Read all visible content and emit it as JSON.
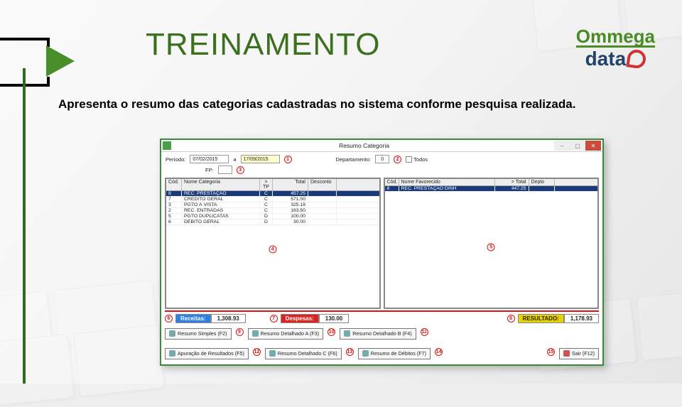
{
  "slide": {
    "title": "TREINAMENTO",
    "logo_top": "Ommega",
    "logo_bot": "data",
    "body": "Apresenta o resumo das categorias cadastradas no sistema conforme pesquisa realizada."
  },
  "window": {
    "title": "Resumo Categoria",
    "filters": {
      "periodo_label": "Período:",
      "periodo_de": "07/02/2015",
      "a_label": "a",
      "periodo_ate": "17/09/2015",
      "departamento_label": "Departamento:",
      "departamento_num": "0",
      "todos_label": "Todos",
      "fp_label": "FP:"
    },
    "left": {
      "headers": {
        "cod": "Cód.",
        "nome": "Nome Categoria",
        "tp": "> TP",
        "total": "Total",
        "desconto": "Desconto"
      },
      "rows": [
        {
          "cod": "8",
          "nome": "REC. PRESTAÇÃO",
          "tp": "C",
          "total": "457.25",
          "desconto": ""
        },
        {
          "cod": "7",
          "nome": "CRÉDITO GERAL",
          "tp": "C",
          "total": "571.00",
          "desconto": ""
        },
        {
          "cod": "3",
          "nome": "PGTO À VISTA",
          "tp": "C",
          "total": "325.18",
          "desconto": ""
        },
        {
          "cod": "2",
          "nome": "REC. ENTRADAS",
          "tp": "C",
          "total": "163.50",
          "desconto": ""
        },
        {
          "cod": "5",
          "nome": "PGTO DUPLICATAS",
          "tp": "D",
          "total": "100.00",
          "desconto": ""
        },
        {
          "cod": "6",
          "nome": "DÉBITO GERAL",
          "tp": "D",
          "total": "30.00",
          "desconto": ""
        }
      ]
    },
    "right": {
      "headers": {
        "cod": "Cód.",
        "nome": "Nome Favorecido",
        "total": "> Total",
        "depto": "Depto"
      },
      "rows": [
        {
          "cod": "8",
          "nome": "REC. PRESTAÇÃO DINH",
          "total": "447.25",
          "depto": ""
        }
      ]
    },
    "totals": {
      "receitas_label": "Receitas:",
      "receitas": "1,308.93",
      "despesas_label": "Despesas:",
      "despesas": "130.00",
      "resultado_label": "RESULTADO:",
      "resultado": "1,178.93"
    },
    "buttons": {
      "b9": "Resumo Simples (F2)",
      "b10": "Resumo Detalhado A (F3)",
      "b11": "Resumo Detalhado B (F4)",
      "b12": "Apuração de Resultados (F5)",
      "b13": "Resumo Detalhado C (F6)",
      "b14": "Resumo de Débitos (F7)",
      "b15": "Sair (F12)"
    },
    "callouts": {
      "c1": "1",
      "c2": "2",
      "c3": "3",
      "c4": "4",
      "c5": "5",
      "c6": "6",
      "c7": "7",
      "c8": "8",
      "c9": "9",
      "c10": "10",
      "c11": "11",
      "c12": "12",
      "c13": "13",
      "c14": "14",
      "c15": "15"
    }
  }
}
